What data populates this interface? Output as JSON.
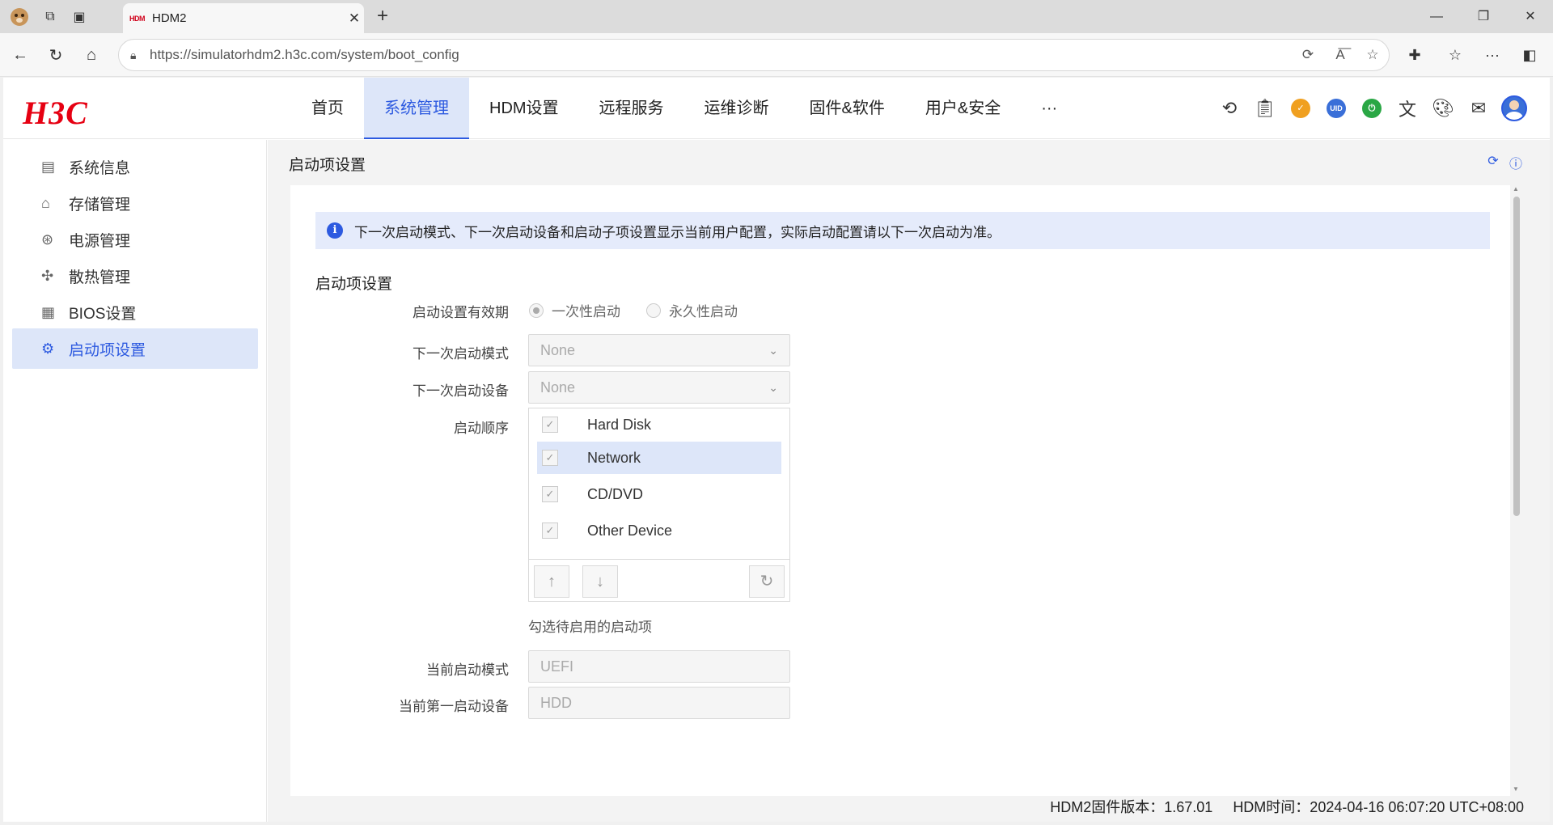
{
  "browser": {
    "tab_title": "HDM2",
    "favicon_text": "HDM",
    "url": "https://simulatorhdm2.h3c.com/system/boot_config"
  },
  "header": {
    "logo": "H3C",
    "nav": [
      "首页",
      "系统管理",
      "HDM设置",
      "远程服务",
      "运维诊断",
      "固件&软件",
      "用户&安全",
      "···"
    ],
    "active_nav": "系统管理",
    "uid_label": "UID"
  },
  "sidebar": {
    "items": [
      {
        "label": "系统信息",
        "icon": "document-icon"
      },
      {
        "label": "存储管理",
        "icon": "storage-icon"
      },
      {
        "label": "电源管理",
        "icon": "power-icon"
      },
      {
        "label": "散热管理",
        "icon": "fan-icon"
      },
      {
        "label": "BIOS设置",
        "icon": "bios-icon"
      },
      {
        "label": "启动项设置",
        "icon": "gear-icon"
      }
    ],
    "active": "启动项设置"
  },
  "page": {
    "title": "启动项设置",
    "notice": "下一次启动模式、下一次启动设备和启动子项设置显示当前用户配置，实际启动配置请以下一次启动为准。",
    "section_title": "启动项设置",
    "fields": {
      "validity_label": "启动设置有效期",
      "validity_options": [
        "一次性启动",
        "永久性启动"
      ],
      "validity_selected": "一次性启动",
      "next_mode_label": "下一次启动模式",
      "next_mode_value": "None",
      "next_device_label": "下一次启动设备",
      "next_device_value": "None",
      "boot_order_label": "启动顺序",
      "boot_order": [
        "Hard Disk",
        "Network",
        "CD/DVD",
        "Other Device"
      ],
      "boot_order_selected": "Network",
      "boot_order_hint": "勾选待启用的启动项",
      "current_mode_label": "当前启动模式",
      "current_mode_value": "UEFI",
      "current_first_device_label": "当前第一启动设备",
      "current_first_device_value": "HDD"
    }
  },
  "footer": {
    "firmware": "HDM2固件版本：1.67.01",
    "time": "HDM时间：2024-04-16 06:07:20 UTC+08:00"
  },
  "colors": {
    "accent": "#2d5ae0",
    "active_bg": "#dde6f9",
    "brand_red": "#e60012",
    "uid_blue": "#3a6fd8",
    "shield_orange": "#f0a020",
    "power_green": "#2aa745"
  }
}
